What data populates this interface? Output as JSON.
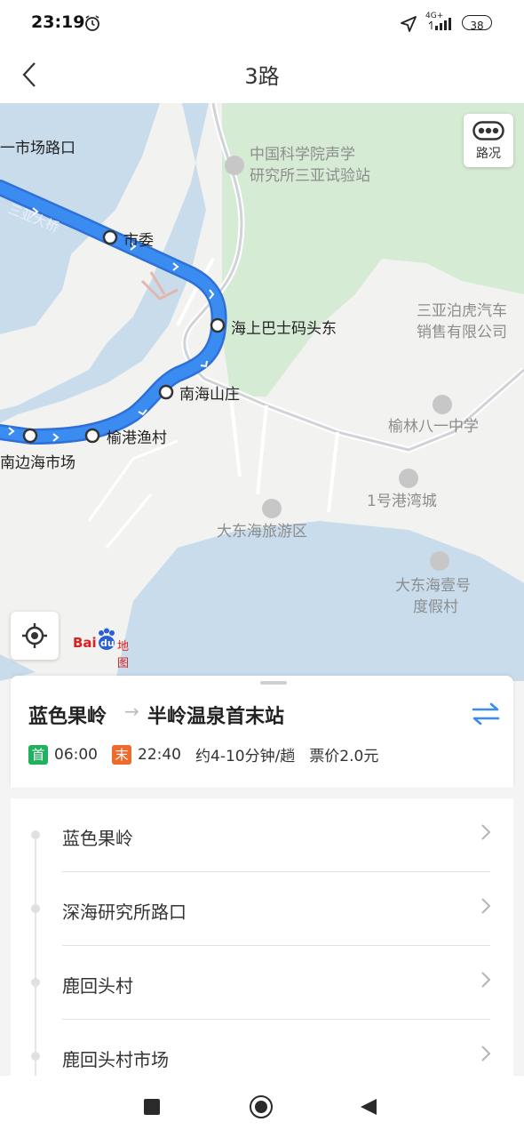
{
  "status_bar": {
    "time": "23:19",
    "network": "4G+",
    "battery": "38",
    "icons": [
      "alarm-icon",
      "location-arrow-icon",
      "signal-icon",
      "battery-icon"
    ]
  },
  "nav": {
    "title": "3路",
    "back_icon": "chevron-left-icon"
  },
  "map": {
    "traffic_label": "路况",
    "route_color": "#3a8cf0",
    "stations": [
      "市委",
      "海上巴士码头东",
      "南海山庄",
      "榆港渔村"
    ],
    "labels": {
      "market_road": "一市场路口",
      "bridge": "三亚大桥",
      "south_market": "南边海市场"
    },
    "pois": {
      "institute_line1": "中国科学院声学",
      "institute_line2": "研究所三亚试验站",
      "auto_line1": "三亚泊虎汽车",
      "auto_line2": "销售有限公司",
      "school": "榆林八一中学",
      "harbor_city": "1号港湾城",
      "tourism_area": "大东海旅游区",
      "resort_line1": "大东海壹号",
      "resort_line2": "度假村"
    },
    "logo": {
      "bai": "Bai",
      "du": "du",
      "map_text": "地图"
    }
  },
  "route": {
    "from": "蓝色果岭",
    "arrow": "→",
    "to": "半岭温泉首末站",
    "first_badge": "首",
    "first_time": "06:00",
    "last_badge": "末",
    "last_time": "22:40",
    "interval": "约4-10分钟/趟",
    "fare": "票价2.0元",
    "first_badge_color": "#1fb15e",
    "last_badge_color": "#ee6b2c"
  },
  "stops": [
    "蓝色果岭",
    "深海研究所路口",
    "鹿回头村",
    "鹿回头村市场"
  ]
}
